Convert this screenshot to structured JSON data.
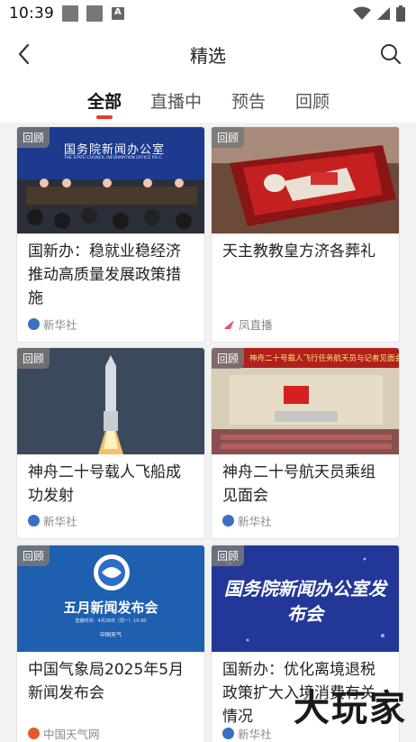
{
  "status_bar": {
    "time": "10:39"
  },
  "header": {
    "title": "精选"
  },
  "tabs": [
    {
      "label": "全部",
      "active": true
    },
    {
      "label": "直播中",
      "active": false
    },
    {
      "label": "预告",
      "active": false
    },
    {
      "label": "回顾",
      "active": false
    }
  ],
  "cards": [
    {
      "badge": "回顾",
      "title": "国新办：稳就业稳经济推动高质量发展政策措施",
      "source": "新华社",
      "thumb_text": "国务院新闻办公室",
      "thumb_subtext": "THE STATE COUNCIL INFORMATION OFFICE P.R.C."
    },
    {
      "badge": "回顾",
      "title": "天主教教皇方济各葬礼",
      "source": "凤直播"
    },
    {
      "badge": "回顾",
      "title": "神舟二十号载人飞船成功发射",
      "source": "新华社"
    },
    {
      "badge": "回顾",
      "title": "神舟二十号航天员乘组见面会",
      "source": "新华社",
      "thumb_text": "神舟二十号载人飞行任务航天员与记者见面会"
    },
    {
      "badge": "回顾",
      "title": "中国气象局2025年5月新闻发布会",
      "source": "中国天气网",
      "thumb_text": "五月新闻发布会",
      "thumb_subtext": "直播时间：4月28日（周一）15:00",
      "thumb_brand": "中国天气"
    },
    {
      "badge": "回顾",
      "title": "国新办：优化离境退税政策扩大入境消费有关情况",
      "source": "新华社",
      "thumb_text": "国务院新闻办公室发布会"
    }
  ],
  "watermark": "大玩家",
  "colors": {
    "accent": "#e8372b",
    "background": "#f2f2f2",
    "badge": "#787878"
  }
}
